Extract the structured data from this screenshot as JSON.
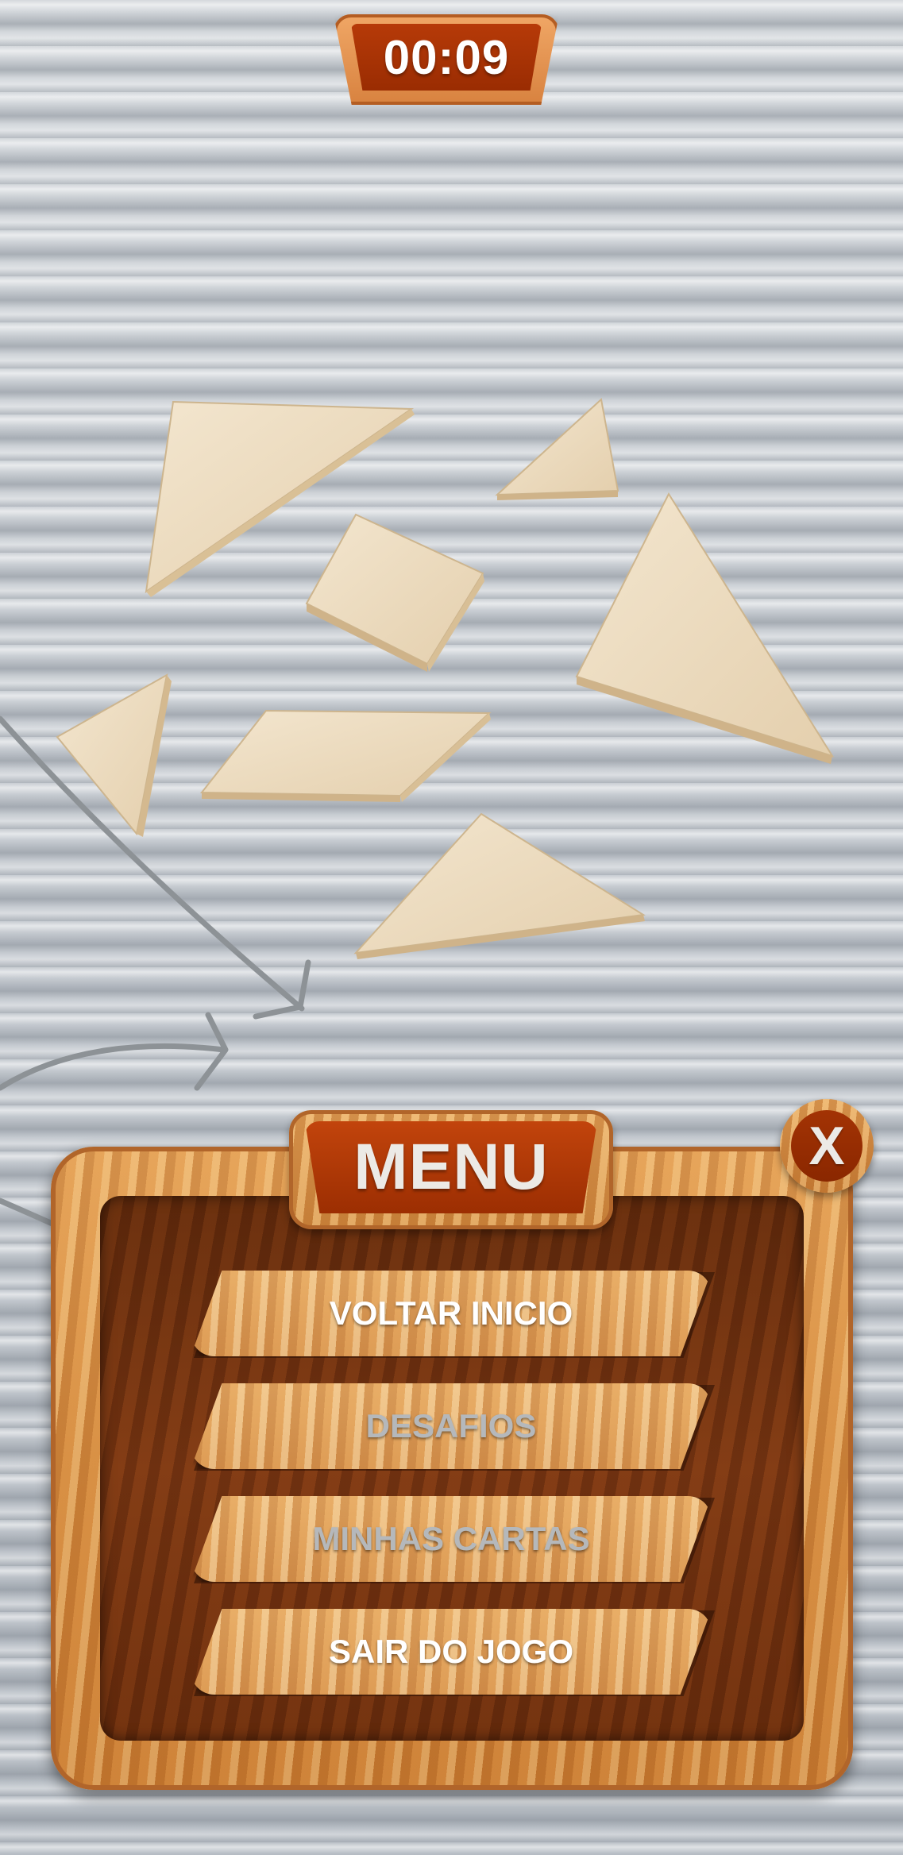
{
  "timer": {
    "value": "00:09"
  },
  "menu": {
    "title": "MENU",
    "close_label": "X",
    "items": [
      {
        "label": "VOLTAR INICIO",
        "enabled": true
      },
      {
        "label": "DESAFIOS",
        "enabled": false
      },
      {
        "label": "MINHAS CARTAS",
        "enabled": false
      },
      {
        "label": "SAIR DO JOGO",
        "enabled": true
      }
    ]
  },
  "game": {
    "tangram_pieces": [
      "large-triangle",
      "large-triangle",
      "medium-triangle",
      "small-triangle",
      "small-triangle",
      "square",
      "parallelogram"
    ]
  },
  "colors": {
    "accent": "#a8330a",
    "wood_light": "#e7a45b",
    "wood_dark": "#6a2e0d",
    "label_enabled": "#ffffff",
    "label_disabled": "#b5b8bb"
  }
}
